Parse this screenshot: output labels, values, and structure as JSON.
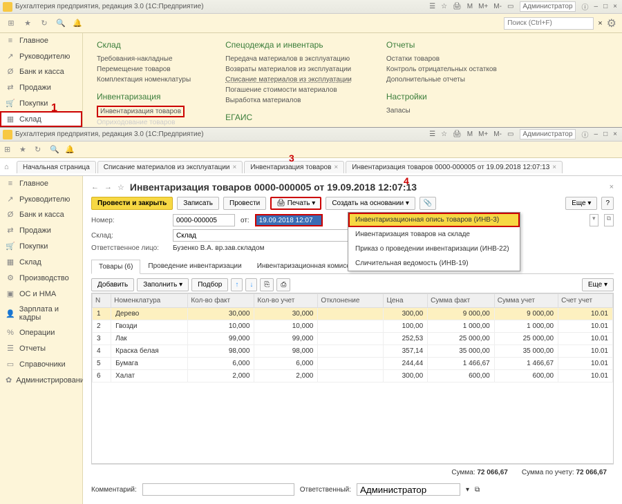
{
  "titlebar1": {
    "title": "Бухгалтерия предприятия, редакция 3.0 (1С:Предприятие)",
    "admin": "Администратор"
  },
  "toolbar_top": {
    "search_placeholder": "Поиск (Ctrl+F)"
  },
  "sidebar1": {
    "items": [
      {
        "icon": "≡",
        "label": "Главное"
      },
      {
        "icon": "↗",
        "label": "Руководителю"
      },
      {
        "icon": "Ø",
        "label": "Банк и касса"
      },
      {
        "icon": "⇄",
        "label": "Продажи"
      },
      {
        "icon": "🛒",
        "label": "Покупки"
      },
      {
        "icon": "▦",
        "label": "Склад"
      }
    ]
  },
  "menu": {
    "col1_h": "Склад",
    "col1": [
      "Требования-накладные",
      "Перемещение товаров",
      "Комплектация номенклатуры"
    ],
    "col1_h2": "Инвентаризация",
    "col1b": [
      "Инвентаризация товаров",
      "Оприходование товаров"
    ],
    "col2_h": "Спецодежда и инвентарь",
    "col2": [
      "Передача материалов в эксплуатацию",
      "Возвраты материалов из эксплуатации",
      "Списание материалов из эксплуатации",
      "Погашение стоимости материалов",
      "Выработка материалов"
    ],
    "col2b_h": "ЕГАИС",
    "col3_h": "Отчеты",
    "col3": [
      "Остатки товаров",
      "Контроль отрицательных остатков",
      "Дополнительные отчеты"
    ],
    "col3_h2": "Настройки",
    "col3b": [
      "Запасы"
    ]
  },
  "markers": {
    "m1": "1",
    "m2": "2",
    "m3": "3",
    "m4": "4"
  },
  "titlebar2": {
    "title": "Бухгалтерия предприятия, редакция 3.0 (1С:Предприятие)",
    "admin": "Администратор"
  },
  "tabs": [
    "Начальная страница",
    "Списание материалов из эксплуатации",
    "Инвентаризация товаров",
    "Инвентаризация товаров 0000-000005 от 19.09.2018 12:07:13"
  ],
  "sidebar2": {
    "items": [
      {
        "icon": "≡",
        "label": "Главное"
      },
      {
        "icon": "↗",
        "label": "Руководителю"
      },
      {
        "icon": "Ø",
        "label": "Банк и касса"
      },
      {
        "icon": "⇄",
        "label": "Продажи"
      },
      {
        "icon": "🛒",
        "label": "Покупки"
      },
      {
        "icon": "▦",
        "label": "Склад"
      },
      {
        "icon": "⚙",
        "label": "Производство"
      },
      {
        "icon": "▣",
        "label": "ОС и НМА"
      },
      {
        "icon": "👤",
        "label": "Зарплата и кадры"
      },
      {
        "icon": "%",
        "label": "Операции"
      },
      {
        "icon": "☰",
        "label": "Отчеты"
      },
      {
        "icon": "▭",
        "label": "Справочники"
      },
      {
        "icon": "✿",
        "label": "Администрирование"
      }
    ]
  },
  "doc": {
    "title": "Инвентаризация товаров 0000-000005 от 19.09.2018 12:07:13",
    "btn_post_close": "Провести и закрыть",
    "btn_save": "Записать",
    "btn_post": "Провести",
    "btn_print": "Печать",
    "btn_create": "Создать на основании",
    "btn_more": "Еще",
    "lbl_number": "Номер:",
    "number": "0000-000005",
    "lbl_date": "от:",
    "date": "19.09.2018 12:07",
    "lbl_store": "Склад:",
    "store": "Склад",
    "lbl_resp": "Ответственное лицо:",
    "resp": "Бузенко В.А. вр.зав.складом",
    "subtabs": [
      "Товары (6)",
      "Проведение инвентаризации",
      "Инвентаризационная комиссия"
    ],
    "btn_add": "Добавить",
    "btn_fill": "Заполнить",
    "btn_pick": "Подбор",
    "dropdown": [
      "Инвентаризационная опись товаров (ИНВ-3)",
      "Инвентаризация товаров на складе",
      "Приказ о проведении инвентаризации (ИНВ-22)",
      "Сличительная ведомость (ИНВ-19)"
    ],
    "cols": [
      "N",
      "Номенклатура",
      "Кол-во факт",
      "Кол-во учет",
      "Отклонение",
      "Цена",
      "Сумма факт",
      "Сумма учет",
      "Счет учет"
    ],
    "rows": [
      {
        "n": "1",
        "name": "Дерево",
        "f": "30,000",
        "u": "30,000",
        "d": "",
        "price": "300,00",
        "sf": "9 000,00",
        "su": "9 000,00",
        "acc": "10.01"
      },
      {
        "n": "2",
        "name": "Гвозди",
        "f": "10,000",
        "u": "10,000",
        "d": "",
        "price": "100,00",
        "sf": "1 000,00",
        "su": "1 000,00",
        "acc": "10.01"
      },
      {
        "n": "3",
        "name": "Лак",
        "f": "99,000",
        "u": "99,000",
        "d": "",
        "price": "252,53",
        "sf": "25 000,00",
        "su": "25 000,00",
        "acc": "10.01"
      },
      {
        "n": "4",
        "name": "Краска белая",
        "f": "98,000",
        "u": "98,000",
        "d": "",
        "price": "357,14",
        "sf": "35 000,00",
        "su": "35 000,00",
        "acc": "10.01"
      },
      {
        "n": "5",
        "name": "Бумага",
        "f": "6,000",
        "u": "6,000",
        "d": "",
        "price": "244,44",
        "sf": "1 466,67",
        "su": "1 466,67",
        "acc": "10.01"
      },
      {
        "n": "6",
        "name": "Халат",
        "f": "2,000",
        "u": "2,000",
        "d": "",
        "price": "300,00",
        "sf": "600,00",
        "su": "600,00",
        "acc": "10.01"
      }
    ],
    "sum_lbl": "Сумма:",
    "sum": "72 066,67",
    "sum2_lbl": "Сумма по учету:",
    "sum2": "72 066,67",
    "lbl_comment": "Комментарий:",
    "lbl_owner": "Ответственный:",
    "owner": "Администратор"
  }
}
